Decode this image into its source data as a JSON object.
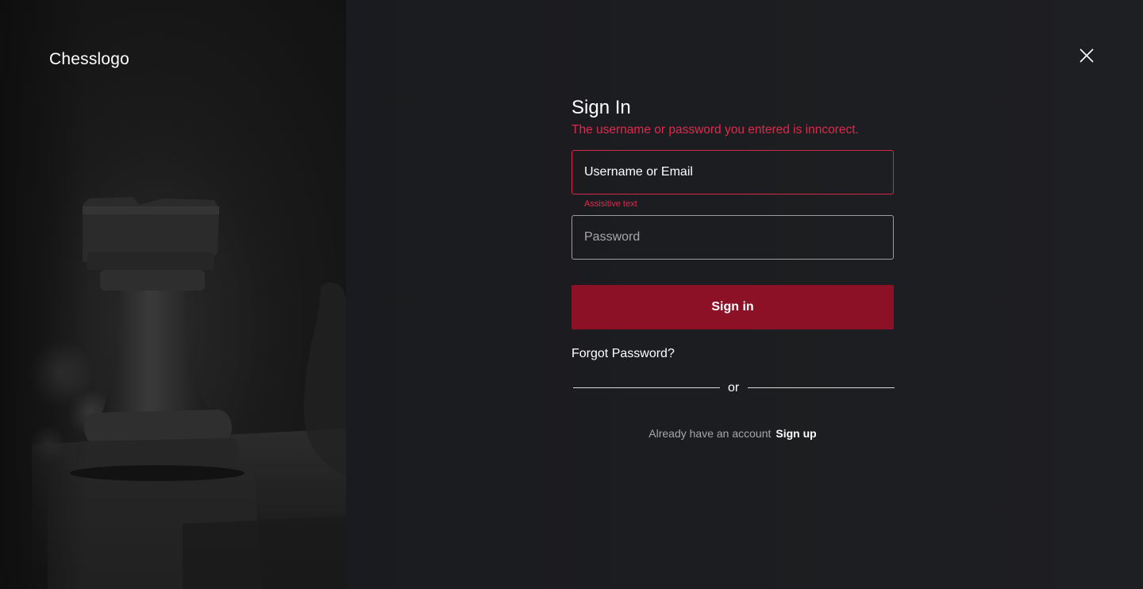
{
  "brand": {
    "name": "Chesslogo"
  },
  "header": {
    "close_icon": "close-icon"
  },
  "form": {
    "title": "Sign In",
    "error_message": "The username or password you entered is inncorect.",
    "username": {
      "placeholder": "Username or Email",
      "helper": "Assisitive text",
      "state": "error"
    },
    "password": {
      "placeholder": "Password"
    },
    "submit_label": "Sign in",
    "forgot_label": "Forgot Password?",
    "divider_label": "or",
    "signup_prompt": "Already have an account",
    "signup_link": "Sign up"
  },
  "colors": {
    "accent": "#8c1026",
    "error": "#e0294e",
    "background": "#1c1d20",
    "text": "#ffffff"
  }
}
